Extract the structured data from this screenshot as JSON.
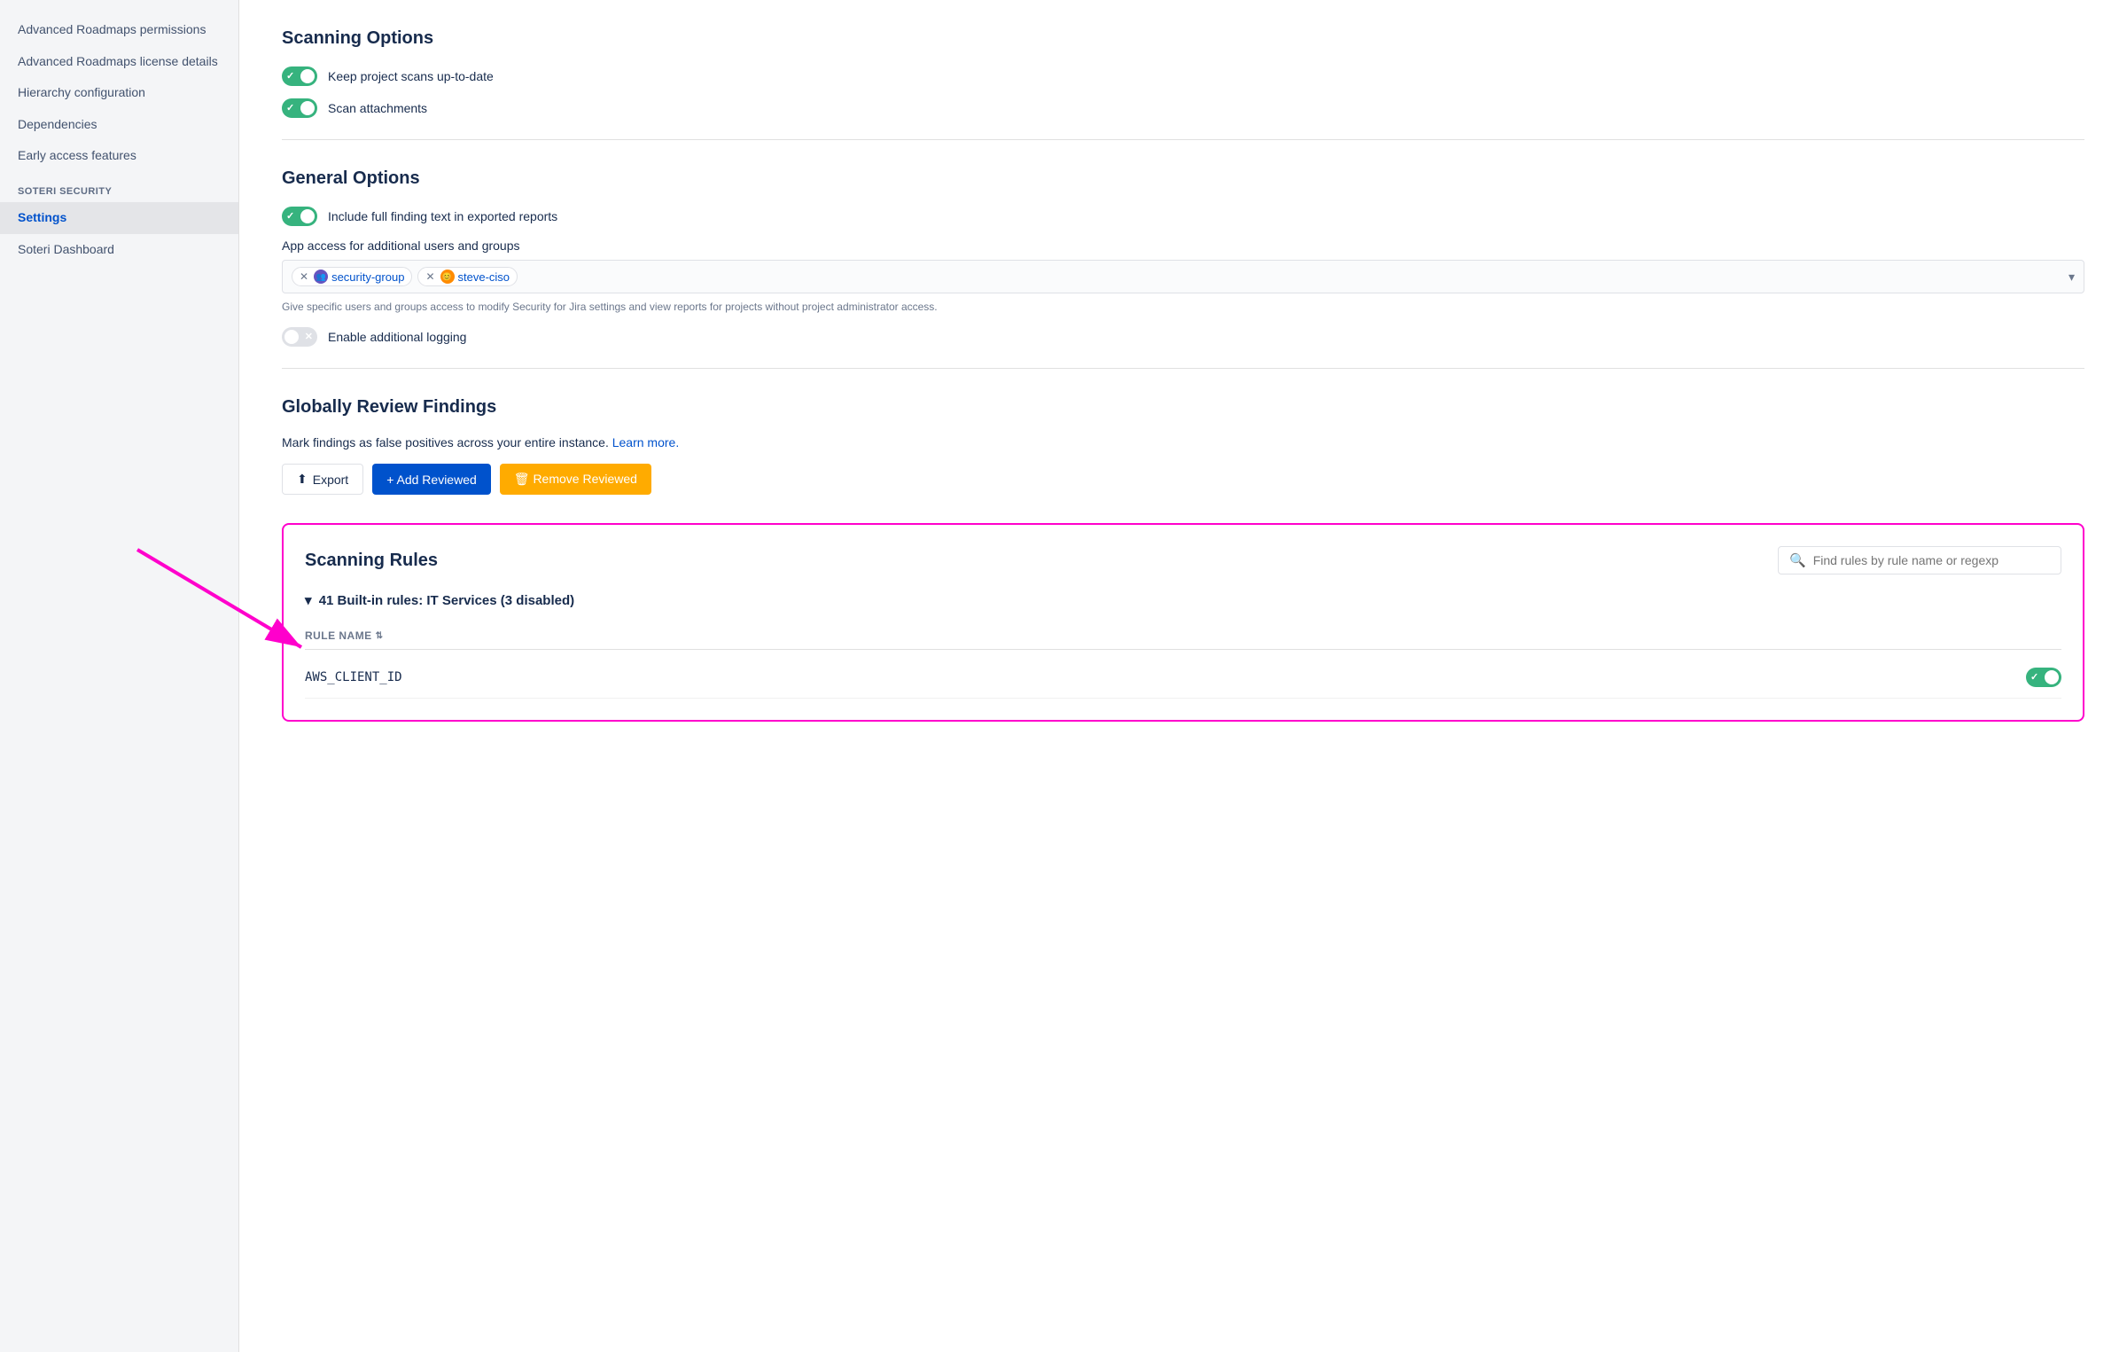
{
  "sidebar": {
    "items": [
      {
        "id": "advanced-roadmaps-permissions",
        "label": "Advanced Roadmaps permissions",
        "active": false
      },
      {
        "id": "advanced-roadmaps-license",
        "label": "Advanced Roadmaps license details",
        "active": false
      },
      {
        "id": "hierarchy-configuration",
        "label": "Hierarchy configuration",
        "active": false
      },
      {
        "id": "dependencies",
        "label": "Dependencies",
        "active": false
      },
      {
        "id": "early-access-features",
        "label": "Early access features",
        "active": false
      }
    ],
    "section_label": "SOTERI SECURITY",
    "soteri_items": [
      {
        "id": "settings",
        "label": "Settings",
        "active": true
      },
      {
        "id": "soteri-dashboard",
        "label": "Soteri Dashboard",
        "active": false
      }
    ]
  },
  "scanning_options": {
    "heading": "Scanning Options",
    "options": [
      {
        "id": "keep-project-scans",
        "label": "Keep project scans up-to-date",
        "on": true
      },
      {
        "id": "scan-attachments",
        "label": "Scan attachments",
        "on": true
      }
    ]
  },
  "general_options": {
    "heading": "General Options",
    "include_full_finding": {
      "label": "Include full finding text in exported reports",
      "on": true
    },
    "app_access_label": "App access for additional users and groups",
    "tags": [
      {
        "id": "security-group",
        "type": "group",
        "label": "security-group"
      },
      {
        "id": "steve-ciso",
        "type": "avatar",
        "label": "steve-ciso"
      }
    ],
    "hint_text": "Give specific users and groups access to modify Security for Jira settings and view reports for projects without project administrator access.",
    "enable_logging": {
      "label": "Enable additional logging",
      "on": false
    }
  },
  "globally_review": {
    "heading": "Globally Review Findings",
    "description": "Mark findings as false positives across your entire instance.",
    "learn_more_text": "Learn more.",
    "learn_more_url": "#",
    "export_label": "Export",
    "add_reviewed_label": "+ Add Reviewed",
    "remove_reviewed_label": "🗑 Remove Reviewed"
  },
  "scanning_rules": {
    "heading": "Scanning Rules",
    "search_placeholder": "Find rules by rule name or regexp",
    "built_in_label": "41 Built-in rules: IT Services (3 disabled)",
    "table_header": "Rule Name",
    "rules": [
      {
        "name": "AWS_CLIENT_ID",
        "enabled": true
      }
    ]
  },
  "arrow": {
    "visible": true
  }
}
